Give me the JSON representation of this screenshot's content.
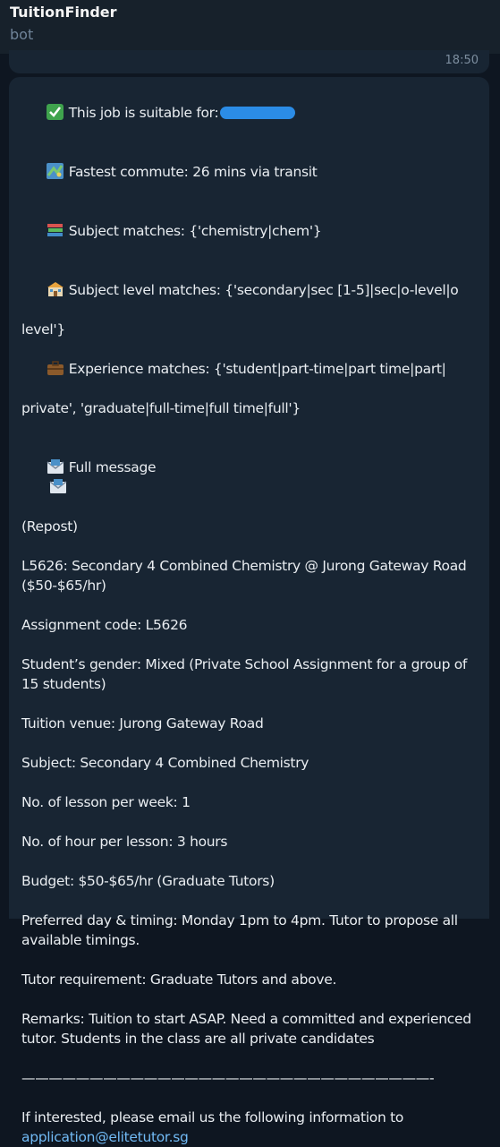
{
  "header": {
    "title": "TuitionFinder",
    "status": "bot"
  },
  "previous_message": {
    "time": "18:50"
  },
  "message": {
    "suitable_label": "This job is suitable for:",
    "commute": "Fastest commute: 26 mins via transit",
    "subject_matches": "Subject matches: {'chemistry|chem'}",
    "level_matches_1": "Subject level matches: {'secondary|sec [1-5]|sec|o-level|o",
    "level_matches_2": "level'}",
    "experience_1": "Experience matches: {'student|part-time|part time|part|",
    "experience_2": "private', 'graduate|full-time|full time|full'}",
    "full_message_label": "Full message",
    "repost": "(Repost)",
    "job_title_1": "L5626: Secondary 4 Combined Chemistry @ Jurong Gateway Road",
    "job_title_2": "($50-$65/hr)",
    "assignment_code": "Assignment code: L5626",
    "gender_1": "Student’s gender: Mixed (Private School Assignment for a group of",
    "gender_2": "15 students)",
    "venue": "Tuition venue: Jurong Gateway Road",
    "subject": "Subject: Secondary 4 Combined Chemistry",
    "lessons": "No. of lesson per week: 1",
    "hours": "No. of hour per lesson: 3 hours",
    "budget": "Budget: $50-$65/hr (Graduate Tutors)",
    "timing_1": "Preferred day & timing: Monday 1pm to 4pm. Tutor to propose all",
    "timing_2": "available timings.",
    "requirement": "Tutor requirement: Graduate Tutors and above.",
    "remarks_1": "Remarks: Tuition to start ASAP. Need a committed and experienced",
    "remarks_2": "tutor. Students in the class are all private candidates",
    "divider": "——————————————————————————————-",
    "interest": "If interested, please email us the following information to",
    "email": "application@elitetutor.sg"
  },
  "colors": {
    "background": "#0e1621",
    "header": "#17212b",
    "bubble": "#182533",
    "link": "#71baf5",
    "muted": "#708499"
  }
}
